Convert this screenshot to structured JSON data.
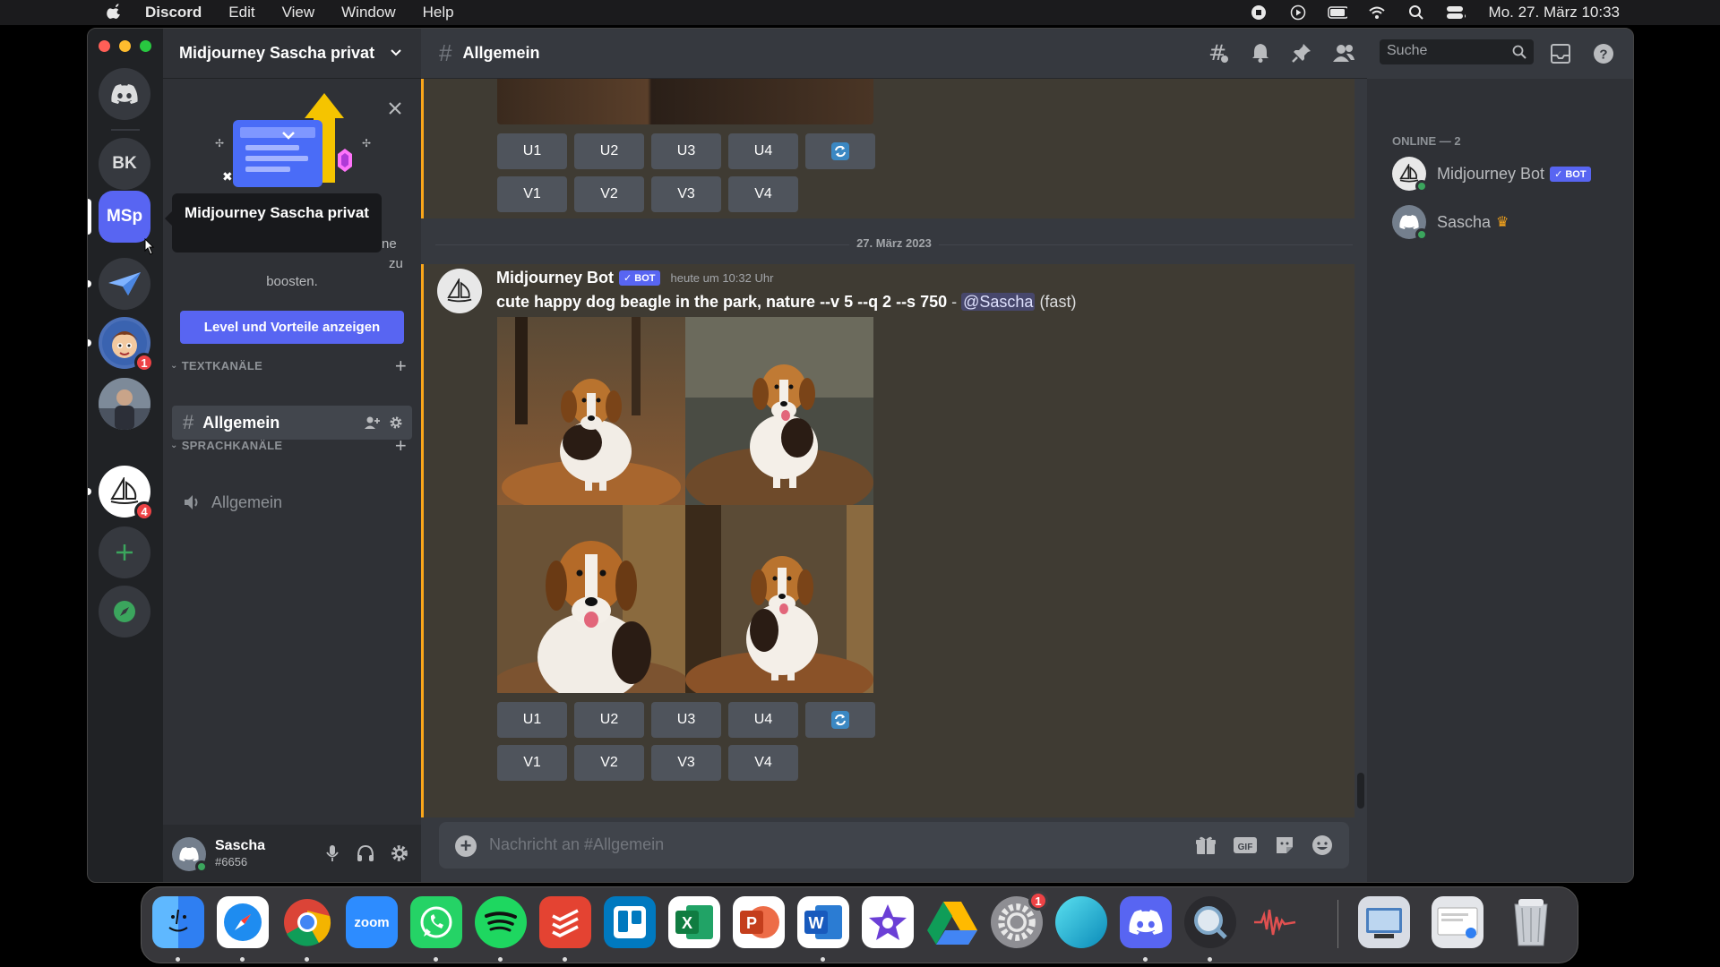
{
  "menubar": {
    "app": "Discord",
    "items": [
      "Edit",
      "View",
      "Window",
      "Help"
    ],
    "clock": "Mo. 27. März 10:33"
  },
  "servers": {
    "bk": "BK",
    "msp": "MSp",
    "badge1": "1",
    "badge2": "4",
    "tooltip": "Midjourney Sascha privat"
  },
  "sidebar": {
    "server_name": "Midjourney Sascha privat",
    "boost_fragment_1": "ne",
    "boost_fragment_2": "zu",
    "boost_text": "boosten.",
    "boost_button": "Level und Vorteile anzeigen",
    "text_category": "TEXTKANÄLE",
    "voice_category": "SPRACHKANÄLE",
    "text_channel": "Allgemein",
    "voice_channel": "Allgemein"
  },
  "user": {
    "name": "Sascha",
    "tag": "#6656"
  },
  "channel": {
    "name": "Allgemein",
    "search_placeholder": "Suche",
    "composer_placeholder": "Nachricht an #Allgemein"
  },
  "messages": {
    "top_buttons_row1": [
      "U1",
      "U2",
      "U3",
      "U4"
    ],
    "top_buttons_row2": [
      "V1",
      "V2",
      "V3",
      "V4"
    ],
    "date_divider": "27. März 2023",
    "author": "Midjourney Bot",
    "bot_badge": "✓ BOT",
    "time": "heute um 10:32 Uhr",
    "prompt": "cute happy dog beagle in the park, nature --v 5 --q 2 --s 750",
    "separator": " - ",
    "mention": "@Sascha",
    "mode": "(fast)",
    "buttons_row1": [
      "U1",
      "U2",
      "U3",
      "U4"
    ],
    "buttons_row2": [
      "V1",
      "V2",
      "V3",
      "V4"
    ]
  },
  "members": {
    "heading": "ONLINE — 2",
    "list": [
      {
        "name": "Midjourney Bot",
        "badge": "✓ BOT"
      },
      {
        "name": "Sascha",
        "crown": "♛"
      }
    ]
  },
  "dock": {
    "zoom": "zoom",
    "settings_badge": "1"
  },
  "colors": {
    "blurple": "#5865f2",
    "highlight_border": "#faa61a",
    "online": "#3ba55d"
  }
}
